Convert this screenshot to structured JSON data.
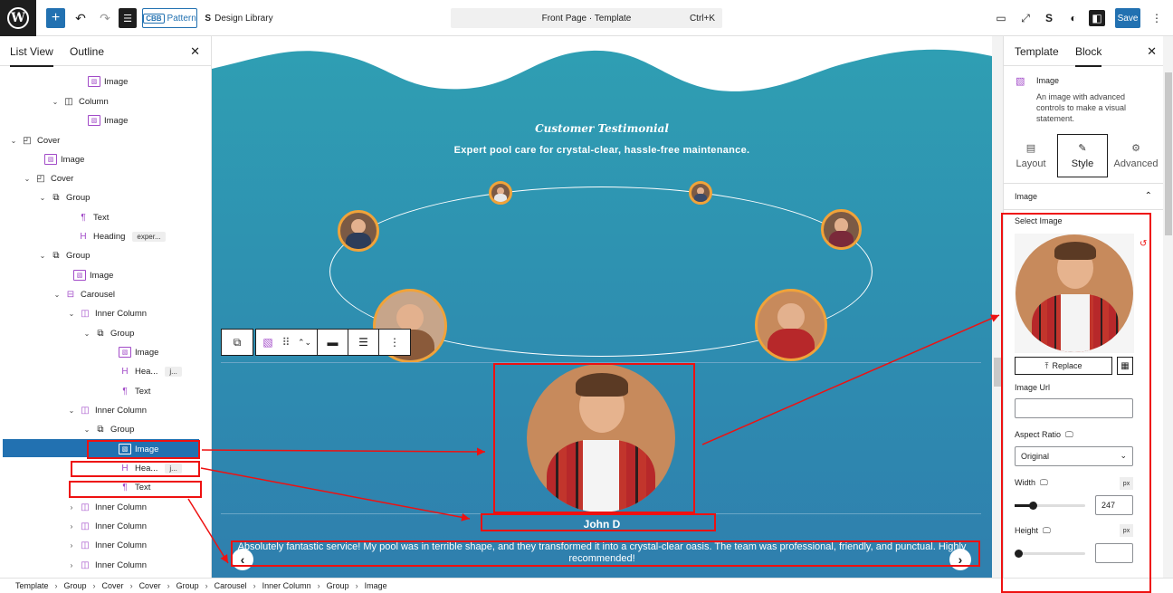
{
  "topbar": {
    "pattern_label": "Pattern",
    "cbb_label": "CBB",
    "design_library_label": "Design Library",
    "doc_title": "Front Page · Template",
    "shortcut": "Ctrl+K",
    "save_label": "Save"
  },
  "left_panel": {
    "tabs": [
      "List View",
      "Outline"
    ],
    "rows": [
      {
        "label": "Image",
        "type": "image"
      },
      {
        "label": "Column",
        "type": "column"
      },
      {
        "label": "Image",
        "type": "image"
      },
      {
        "label": "Cover",
        "type": "cover"
      },
      {
        "label": "Image",
        "type": "image"
      },
      {
        "label": "Cover",
        "type": "cover"
      },
      {
        "label": "Group",
        "type": "group"
      },
      {
        "label": "Text",
        "type": "text"
      },
      {
        "label": "Heading",
        "type": "heading",
        "pill": "exper..."
      },
      {
        "label": "Group",
        "type": "group"
      },
      {
        "label": "Image",
        "type": "image"
      },
      {
        "label": "Carousel",
        "type": "carousel"
      },
      {
        "label": "Inner Column",
        "type": "innercol"
      },
      {
        "label": "Group",
        "type": "group"
      },
      {
        "label": "Image",
        "type": "image"
      },
      {
        "label": "Hea...",
        "type": "heading",
        "pill": "j..."
      },
      {
        "label": "Text",
        "type": "text"
      },
      {
        "label": "Inner Column",
        "type": "innercol"
      },
      {
        "label": "Group",
        "type": "group"
      },
      {
        "label": "Image",
        "type": "image"
      },
      {
        "label": "Hea...",
        "type": "heading",
        "pill": "j..."
      },
      {
        "label": "Text",
        "type": "text"
      },
      {
        "label": "Inner Column",
        "type": "innercol"
      },
      {
        "label": "Inner Column",
        "type": "innercol"
      },
      {
        "label": "Inner Column",
        "type": "innercol"
      },
      {
        "label": "Inner Column",
        "type": "innercol"
      }
    ]
  },
  "canvas": {
    "title": "Customer Testimonial",
    "subtitle": "Expert pool care for crystal-clear, hassle-free maintenance.",
    "name": "John D",
    "quote": "Absolutely fantastic service! My pool was in terrible shape, and they transformed it into a crystal-clear oasis. The team was professional, friendly, and punctual. Highly recommended!",
    "prev": "‹",
    "next": "›"
  },
  "right_panel": {
    "tabs": [
      "Template",
      "Block"
    ],
    "block_name": "Image",
    "block_desc": "An image with advanced controls to make a visual statement.",
    "subtabs": [
      "Layout",
      "Style",
      "Advanced"
    ],
    "section": "Image",
    "select_image_label": "Select Image",
    "replace_label": "Replace",
    "image_url_label": "Image Url",
    "image_url_value": "",
    "aspect_ratio_label": "Aspect Ratio",
    "aspect_ratio_value": "Original",
    "width_label": "Width",
    "width_unit": "px",
    "width_value": "247",
    "width_slider_fraction": 0.25,
    "height_label": "Height",
    "height_unit": "px",
    "height_value": "",
    "height_slider_fraction": 0.0
  },
  "breadcrumb": [
    "Template",
    "Group",
    "Cover",
    "Cover",
    "Group",
    "Carousel",
    "Inner Column",
    "Group",
    "Image"
  ],
  "colors": {
    "accent": "#2271b1",
    "annotation": "#e11111",
    "canvas_bg": "#2e8cb0",
    "avatar_ring": "#f0a33a"
  }
}
